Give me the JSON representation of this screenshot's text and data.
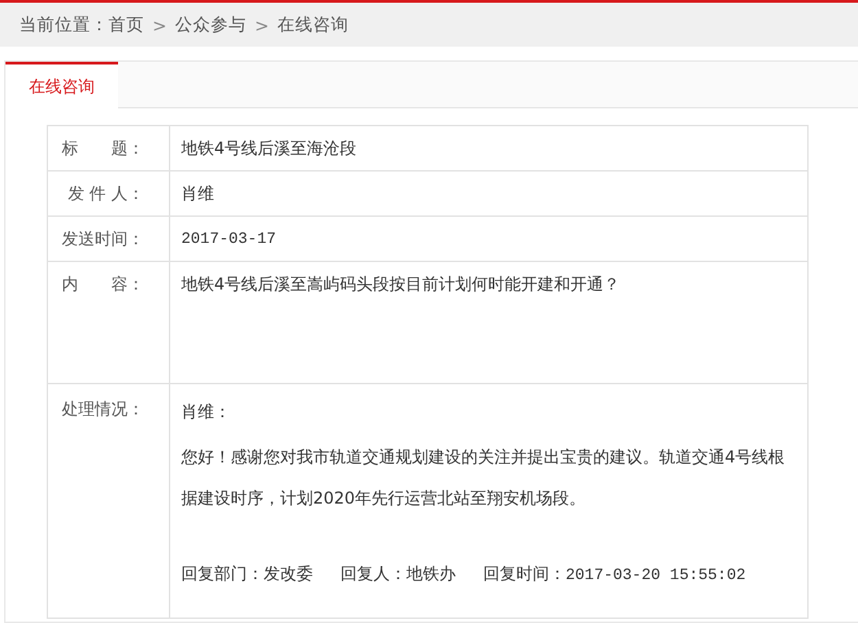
{
  "breadcrumb": {
    "label": "当前位置：",
    "items": [
      {
        "text": "首页"
      },
      {
        "sep": ">",
        "text": "公众参与"
      },
      {
        "sep": ">",
        "text": "在线咨询"
      }
    ]
  },
  "tabs": [
    {
      "label": "在线咨询",
      "selected": true
    }
  ],
  "fields": [
    {
      "label": "标　　题：",
      "value": "地铁4号线后溪至海沧段",
      "kind": "text"
    },
    {
      "label": "发 件 人：",
      "value": "肖维",
      "kind": "text"
    },
    {
      "label": "发送时间：",
      "value": "2017-03-17",
      "kind": "date"
    },
    {
      "label": "内　　容：",
      "value": "地铁4号线后溪至嵩屿码头段按目前计划何时能开建和开通？",
      "kind": "content"
    }
  ],
  "reply": {
    "label": "处理情况：",
    "greeting": "肖维：",
    "body": "您好！感谢您对我市轨道交通规划建设的关注并提出宝贵的建议。轨道交通4号线根据建设时序，计划2020年先行运营北站至翔安机场段。",
    "meta": [
      {
        "label": "回复部门：",
        "value": "发改委",
        "kind": "text"
      },
      {
        "label": "回复人：",
        "value": "地铁办",
        "kind": "text"
      },
      {
        "label": "回复时间：",
        "value": "2017-03-20 15:55:02",
        "kind": "date"
      }
    ]
  }
}
